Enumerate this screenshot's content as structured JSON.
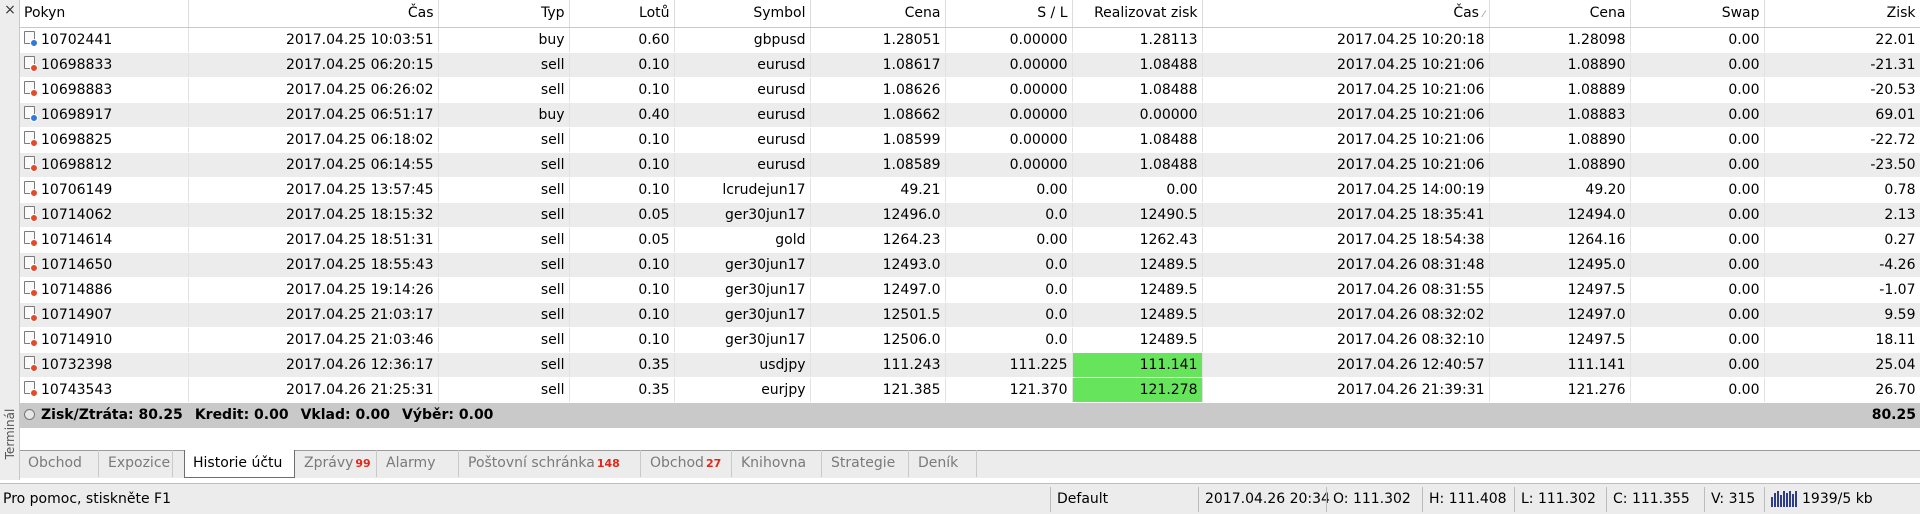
{
  "side_panel": {
    "close": "×",
    "label": "Terminál"
  },
  "columns": [
    "Pokyn",
    "Čas",
    "Typ",
    "Lotů",
    "Symbol",
    "Cena",
    "S / L",
    "Realizovat zisk",
    "Čas",
    "Cena",
    "Swap",
    "Zisk"
  ],
  "rows": [
    {
      "order": "10702441",
      "open_time": "2017.04.25 10:03:51",
      "type": "buy",
      "lots": "0.60",
      "symbol": "gbpusd",
      "open_price": "1.28051",
      "sl": "0.00000",
      "tp": "1.28113",
      "close_time": "2017.04.25 10:20:18",
      "close_price": "1.28098",
      "swap": "0.00",
      "profit": "22.01"
    },
    {
      "order": "10698833",
      "open_time": "2017.04.25 06:20:15",
      "type": "sell",
      "lots": "0.10",
      "symbol": "eurusd",
      "open_price": "1.08617",
      "sl": "0.00000",
      "tp": "1.08488",
      "close_time": "2017.04.25 10:21:06",
      "close_price": "1.08890",
      "swap": "0.00",
      "profit": "-21.31"
    },
    {
      "order": "10698883",
      "open_time": "2017.04.25 06:26:02",
      "type": "sell",
      "lots": "0.10",
      "symbol": "eurusd",
      "open_price": "1.08626",
      "sl": "0.00000",
      "tp": "1.08488",
      "close_time": "2017.04.25 10:21:06",
      "close_price": "1.08889",
      "swap": "0.00",
      "profit": "-20.53"
    },
    {
      "order": "10698917",
      "open_time": "2017.04.25 06:51:17",
      "type": "buy",
      "lots": "0.40",
      "symbol": "eurusd",
      "open_price": "1.08662",
      "sl": "0.00000",
      "tp": "0.00000",
      "close_time": "2017.04.25 10:21:06",
      "close_price": "1.08883",
      "swap": "0.00",
      "profit": "69.01"
    },
    {
      "order": "10698825",
      "open_time": "2017.04.25 06:18:02",
      "type": "sell",
      "lots": "0.10",
      "symbol": "eurusd",
      "open_price": "1.08599",
      "sl": "0.00000",
      "tp": "1.08488",
      "close_time": "2017.04.25 10:21:06",
      "close_price": "1.08890",
      "swap": "0.00",
      "profit": "-22.72"
    },
    {
      "order": "10698812",
      "open_time": "2017.04.25 06:14:55",
      "type": "sell",
      "lots": "0.10",
      "symbol": "eurusd",
      "open_price": "1.08589",
      "sl": "0.00000",
      "tp": "1.08488",
      "close_time": "2017.04.25 10:21:06",
      "close_price": "1.08890",
      "swap": "0.00",
      "profit": "-23.50"
    },
    {
      "order": "10706149",
      "open_time": "2017.04.25 13:57:45",
      "type": "sell",
      "lots": "0.10",
      "symbol": "lcrudejun17",
      "open_price": "49.21",
      "sl": "0.00",
      "tp": "0.00",
      "close_time": "2017.04.25 14:00:19",
      "close_price": "49.20",
      "swap": "0.00",
      "profit": "0.78"
    },
    {
      "order": "10714062",
      "open_time": "2017.04.25 18:15:32",
      "type": "sell",
      "lots": "0.05",
      "symbol": "ger30jun17",
      "open_price": "12496.0",
      "sl": "0.0",
      "tp": "12490.5",
      "close_time": "2017.04.25 18:35:41",
      "close_price": "12494.0",
      "swap": "0.00",
      "profit": "2.13"
    },
    {
      "order": "10714614",
      "open_time": "2017.04.25 18:51:31",
      "type": "sell",
      "lots": "0.05",
      "symbol": "gold",
      "open_price": "1264.23",
      "sl": "0.00",
      "tp": "1262.43",
      "close_time": "2017.04.25 18:54:38",
      "close_price": "1264.16",
      "swap": "0.00",
      "profit": "0.27"
    },
    {
      "order": "10714650",
      "open_time": "2017.04.25 18:55:43",
      "type": "sell",
      "lots": "0.10",
      "symbol": "ger30jun17",
      "open_price": "12493.0",
      "sl": "0.0",
      "tp": "12489.5",
      "close_time": "2017.04.26 08:31:48",
      "close_price": "12495.0",
      "swap": "0.00",
      "profit": "-4.26"
    },
    {
      "order": "10714886",
      "open_time": "2017.04.25 19:14:26",
      "type": "sell",
      "lots": "0.10",
      "symbol": "ger30jun17",
      "open_price": "12497.0",
      "sl": "0.0",
      "tp": "12489.5",
      "close_time": "2017.04.26 08:31:55",
      "close_price": "12497.5",
      "swap": "0.00",
      "profit": "-1.07"
    },
    {
      "order": "10714907",
      "open_time": "2017.04.25 21:03:17",
      "type": "sell",
      "lots": "0.10",
      "symbol": "ger30jun17",
      "open_price": "12501.5",
      "sl": "0.0",
      "tp": "12489.5",
      "close_time": "2017.04.26 08:32:02",
      "close_price": "12497.0",
      "swap": "0.00",
      "profit": "9.59"
    },
    {
      "order": "10714910",
      "open_time": "2017.04.25 21:03:46",
      "type": "sell",
      "lots": "0.10",
      "symbol": "ger30jun17",
      "open_price": "12506.0",
      "sl": "0.0",
      "tp": "12489.5",
      "close_time": "2017.04.26 08:32:10",
      "close_price": "12497.5",
      "swap": "0.00",
      "profit": "18.11"
    },
    {
      "order": "10732398",
      "open_time": "2017.04.26 12:36:17",
      "type": "sell",
      "lots": "0.35",
      "symbol": "usdjpy",
      "open_price": "111.243",
      "sl": "111.225",
      "tp": "111.141",
      "close_time": "2017.04.26 12:40:57",
      "close_price": "111.141",
      "swap": "0.00",
      "profit": "25.04",
      "tp_highlight": true
    },
    {
      "order": "10743543",
      "open_time": "2017.04.26 21:25:31",
      "type": "sell",
      "lots": "0.35",
      "symbol": "eurjpy",
      "open_price": "121.385",
      "sl": "121.370",
      "tp": "121.278",
      "close_time": "2017.04.26 21:39:31",
      "close_price": "121.276",
      "swap": "0.00",
      "profit": "26.70",
      "tp_highlight": true
    }
  ],
  "summary": {
    "profit_loss": "Zisk/Ztráta: 80.25",
    "credit": "Kredit: 0.00",
    "deposit": "Vklad: 0.00",
    "withdrawal": "Výběr: 0.00",
    "total": "80.25"
  },
  "tabs": [
    {
      "label": "Obchod",
      "count": ""
    },
    {
      "label": "Expozice",
      "count": ""
    },
    {
      "label": "Historie účtu",
      "count": "",
      "active": true
    },
    {
      "label": "Zprávy",
      "count": "99"
    },
    {
      "label": "Alarmy",
      "count": ""
    },
    {
      "label": "Poštovní schránka",
      "count": "148"
    },
    {
      "label": "Obchod",
      "count": "27"
    },
    {
      "label": "Knihovna",
      "count": ""
    },
    {
      "label": "Strategie",
      "count": ""
    },
    {
      "label": "Deník",
      "count": ""
    }
  ],
  "status_bar": {
    "help": "Pro pomoc, stiskněte F1",
    "profile": "Default",
    "datetime": "2017.04.26 20:34",
    "open": "O: 111.302",
    "high": "H: 111.408",
    "low": "L: 111.302",
    "close": "C: 111.355",
    "volume": "V: 315",
    "traffic": "1939/5 kb"
  },
  "colors": {
    "highlight_green": "#66e45c",
    "row_alt": "#ececec",
    "tab_count_red": "#e0281c",
    "buy_dot": "#2f79d8",
    "sell_dot": "#e24a2a"
  }
}
